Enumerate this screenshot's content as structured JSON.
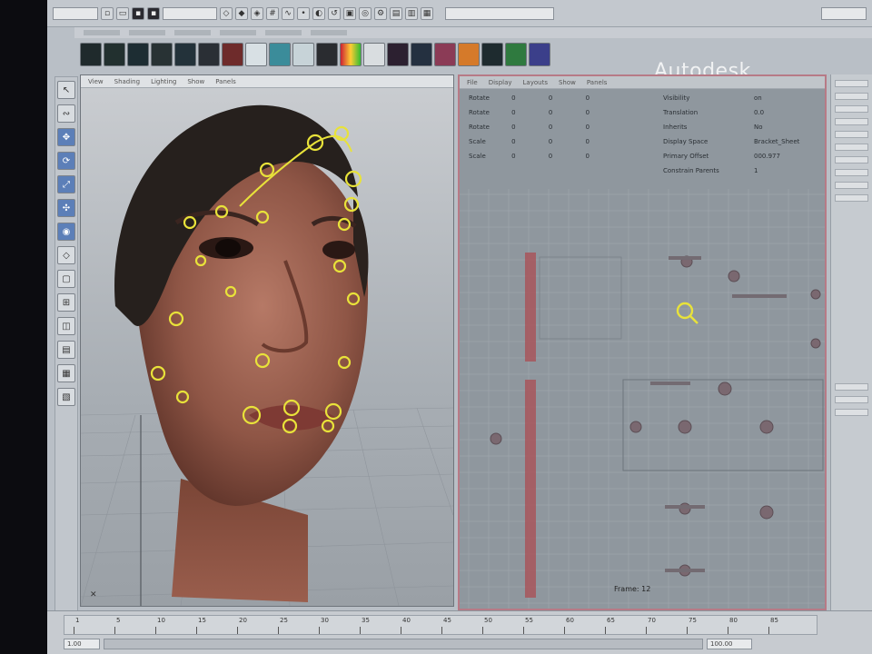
{
  "app": {
    "brand": "Autodesk"
  },
  "viewport": {
    "menu": [
      "View",
      "Shading",
      "Lighting",
      "Show",
      "Panels"
    ]
  },
  "graph_panel": {
    "menu": [
      "File",
      "Display",
      "Layouts",
      "Show",
      "Panels"
    ],
    "attributes_left": [
      {
        "label": "Rotate",
        "values": [
          "0",
          "0",
          "0"
        ]
      },
      {
        "label": "Rotate",
        "values": [
          "0",
          "0",
          "0"
        ]
      },
      {
        "label": "Rotate",
        "values": [
          "0",
          "0",
          "0"
        ]
      },
      {
        "label": "Scale",
        "values": [
          "0",
          "0",
          "0"
        ]
      },
      {
        "label": "Scale",
        "values": [
          "0",
          "0",
          "0"
        ]
      }
    ],
    "attributes_right": [
      {
        "label": "Visibility",
        "value": "on"
      },
      {
        "label": "Translation",
        "value": "0.0"
      },
      {
        "label": "Inherits",
        "value": "No"
      },
      {
        "label": "Display Space",
        "value": "Bracket_Sheet"
      },
      {
        "label": "Primary Offset",
        "value": "000.977"
      },
      {
        "label": "Constrain Parents",
        "value": "1"
      }
    ],
    "frame_readout": "Frame: 12"
  },
  "timeline": {
    "ticks": [
      "1",
      "5",
      "10",
      "15",
      "20",
      "25",
      "30",
      "35",
      "40",
      "45",
      "50",
      "55",
      "60",
      "65",
      "70",
      "75",
      "80",
      "85"
    ],
    "range_start": "1.00",
    "range_end": "100.00"
  }
}
